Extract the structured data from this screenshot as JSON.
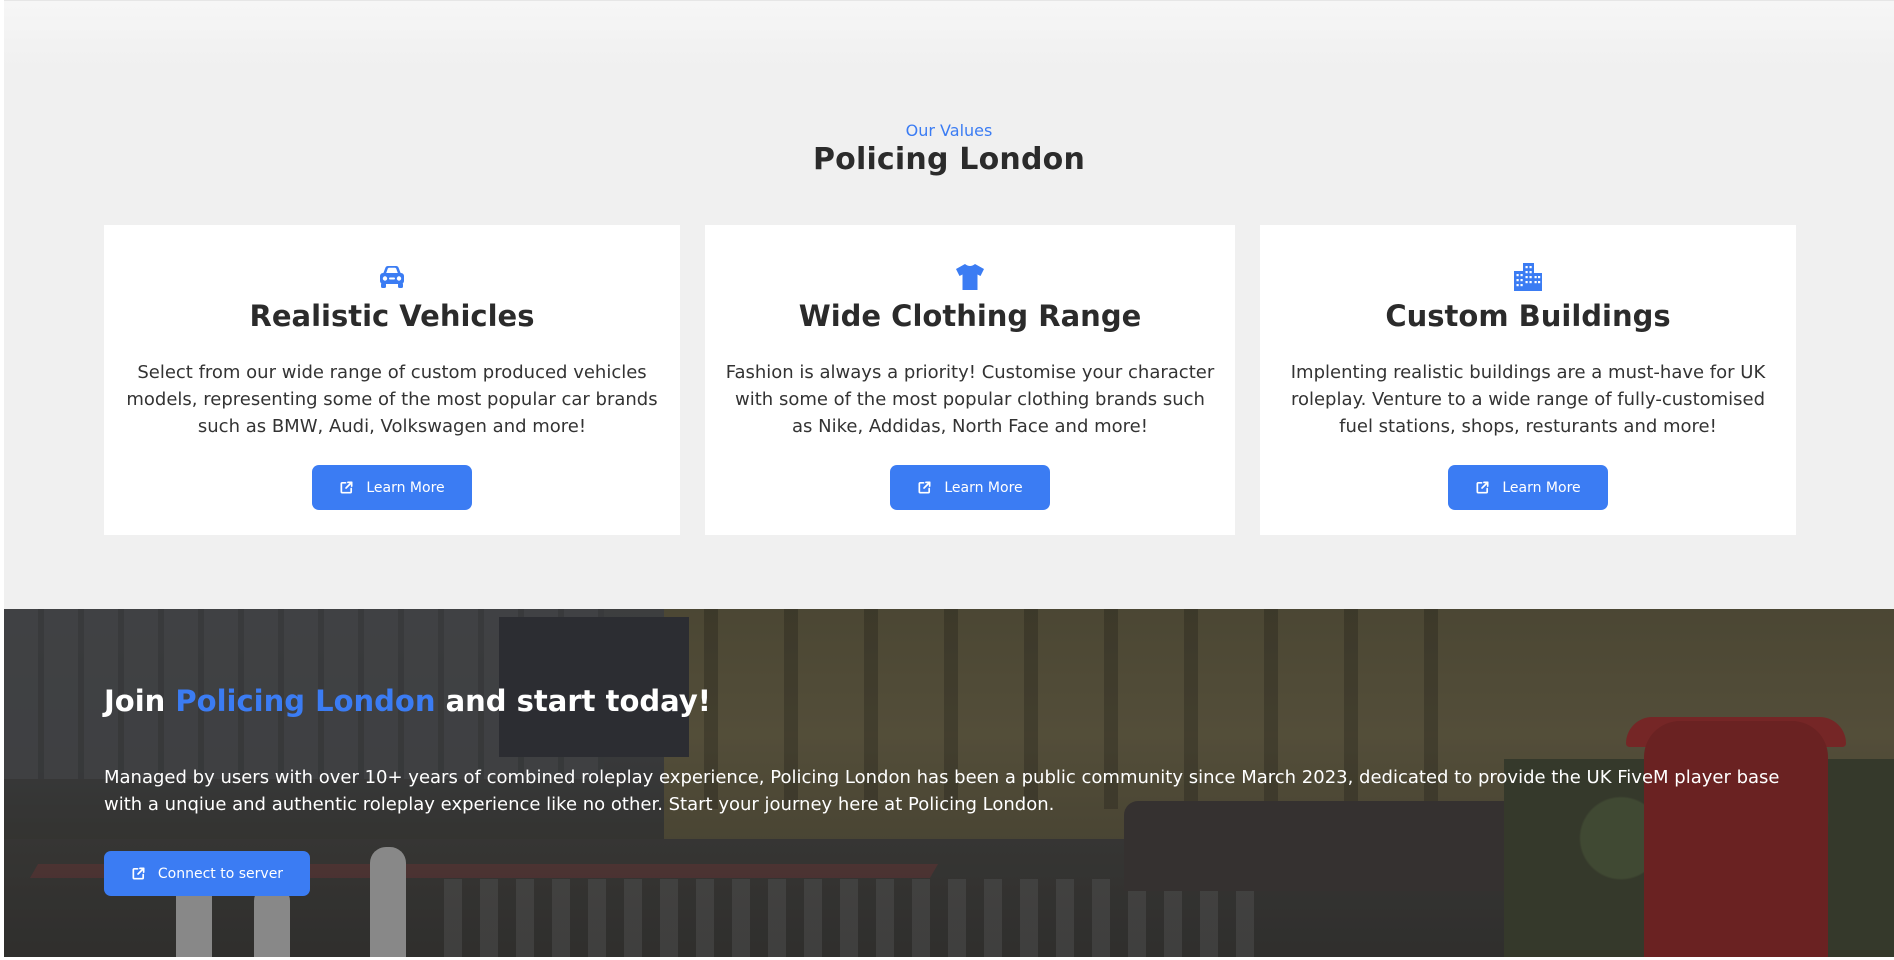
{
  "values": {
    "eyebrow": "Our Values",
    "title": "Policing London",
    "cards": [
      {
        "icon": "car-icon",
        "title": "Realistic Vehicles",
        "text": "Select from our wide range of custom produced vehicles models, representing some of the most popular car brands such as BMW, Audi, Volkswagen and more!",
        "button_label": "Learn More"
      },
      {
        "icon": "tshirt-icon",
        "title": "Wide Clothing Range",
        "text": "Fashion is always a priority! Customise your character with some of the most popular clothing brands such as Nike, Addidas, North Face and more!",
        "button_label": "Learn More"
      },
      {
        "icon": "buildings-icon",
        "title": "Custom Buildings",
        "text": "Implenting realistic buildings are a must-have for UK roleplay. Venture to a wide range of fully-customised fuel stations, shops, resturants and more!",
        "button_label": "Learn More"
      }
    ]
  },
  "join": {
    "title_prefix": "Join ",
    "title_accent": "Policing London",
    "title_suffix": " and start today!",
    "text": "Managed by users with over 10+ years of combined roleplay experience, Policing London has been a public community since March 2023, dedicated to provide the UK FiveM player base with a unqiue and authentic roleplay experience like no other. Start your journey here at Policing London.",
    "button_label": "Connect to server"
  },
  "colors": {
    "accent": "#3b7cf3",
    "section_bg": "#f0f0f0",
    "card_bg": "#ffffff",
    "text": "#2b2b2b"
  }
}
